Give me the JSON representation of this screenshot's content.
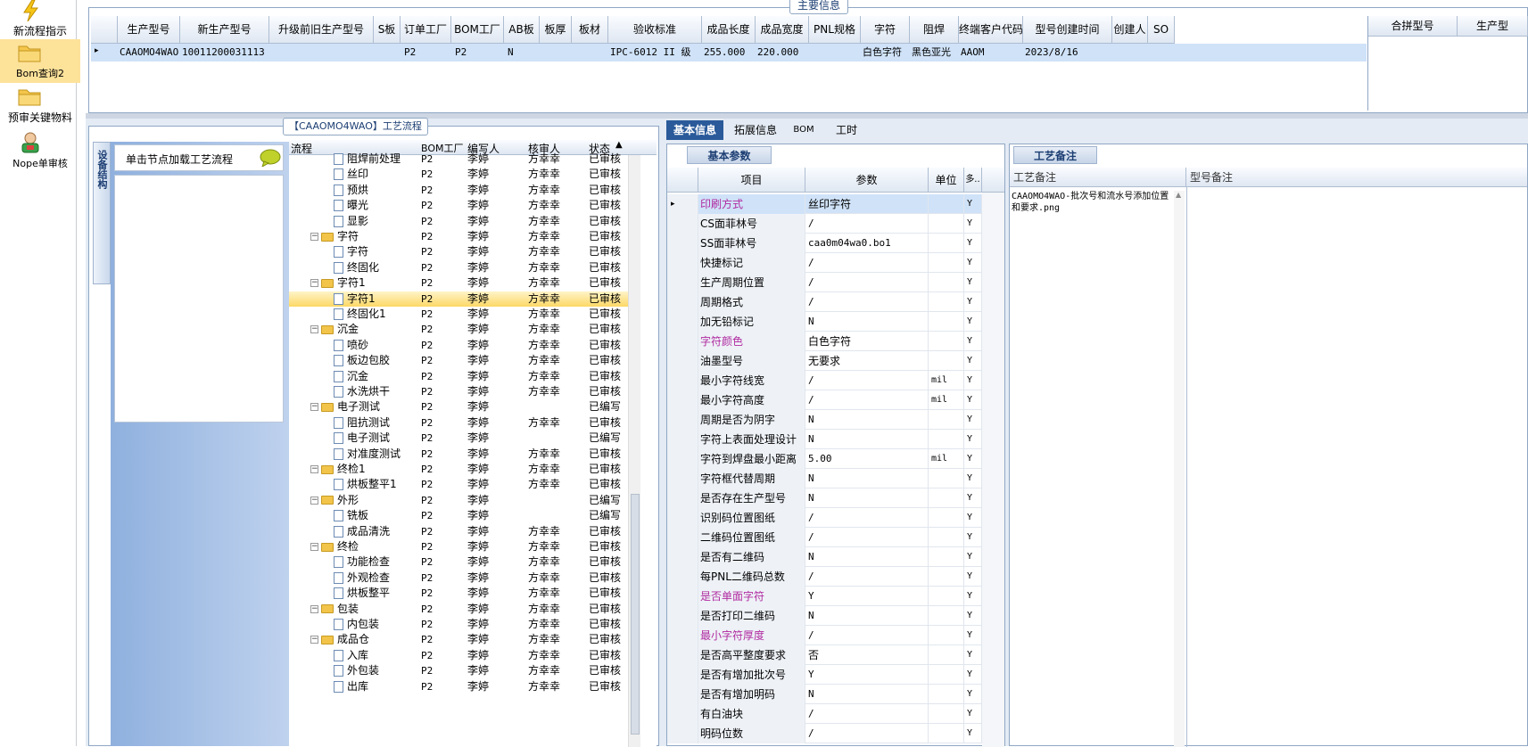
{
  "launcher": {
    "items": [
      {
        "label": "新流程指示"
      },
      {
        "label": "Bom查询2"
      },
      {
        "label": "预审关键物料"
      },
      {
        "label": "Nope单审核"
      }
    ]
  },
  "main_info": {
    "title": "主要信息",
    "columns": [
      "生产型号",
      "新生产型号",
      "升级前旧生产型号",
      "S板",
      "订单工厂",
      "BOM工厂",
      "AB板",
      "板厚",
      "板材",
      "验收标准",
      "成品长度",
      "成品宽度",
      "PNL规格",
      "字符",
      "阻焊",
      "终端客户代码",
      "型号创建时间",
      "创建人",
      "SO"
    ],
    "row": {
      "生产型号": "CAAOMO4WAO",
      "新生产型号": "10011200031113",
      "升级前旧生产型号": "",
      "S板": "",
      "订单工厂": "P2",
      "BOM工厂": "P2",
      "AB板": "N",
      "板厚": "",
      "板材": "",
      "验收标准": "IPC-6012 II 级",
      "成品长度": "255.000",
      "成品宽度": "220.000",
      "PNL规格": "",
      "字符": "白色字符",
      "阻焊": "黑色亚光",
      "终端客户代码": "AAOM",
      "型号创建时间": "2023/8/16",
      "创建人": "",
      "SO": ""
    },
    "right_columns": [
      "合拼型号",
      "生产型"
    ]
  },
  "process": {
    "title": "【CAAOMO4WAO】工艺流程",
    "side_tab": "设备结构",
    "hint": "单击节点加载工艺流程",
    "columns": [
      "流程",
      "BOM工厂",
      "编写人",
      "核审人",
      "状态"
    ],
    "rows": [
      {
        "name": "阻焊前处理",
        "level": 2,
        "kind": "doc",
        "bom": "P2",
        "writer": "李婷",
        "reviewer": "方幸幸",
        "status": "已审核"
      },
      {
        "name": "丝印",
        "level": 2,
        "kind": "doc",
        "bom": "P2",
        "writer": "李婷",
        "reviewer": "方幸幸",
        "status": "已审核"
      },
      {
        "name": "预烘",
        "level": 2,
        "kind": "doc",
        "bom": "P2",
        "writer": "李婷",
        "reviewer": "方幸幸",
        "status": "已审核"
      },
      {
        "name": "曝光",
        "level": 2,
        "kind": "doc",
        "bom": "P2",
        "writer": "李婷",
        "reviewer": "方幸幸",
        "status": "已审核"
      },
      {
        "name": "显影",
        "level": 2,
        "kind": "doc",
        "bom": "P2",
        "writer": "李婷",
        "reviewer": "方幸幸",
        "status": "已审核"
      },
      {
        "name": "字符",
        "level": 1,
        "kind": "folder",
        "bom": "P2",
        "writer": "李婷",
        "reviewer": "方幸幸",
        "status": "已审核"
      },
      {
        "name": "字符",
        "level": 2,
        "kind": "doc",
        "bom": "P2",
        "writer": "李婷",
        "reviewer": "方幸幸",
        "status": "已审核"
      },
      {
        "name": "终固化",
        "level": 2,
        "kind": "doc",
        "bom": "P2",
        "writer": "李婷",
        "reviewer": "方幸幸",
        "status": "已审核"
      },
      {
        "name": "字符1",
        "level": 1,
        "kind": "folder",
        "bom": "P2",
        "writer": "李婷",
        "reviewer": "方幸幸",
        "status": "已审核"
      },
      {
        "name": "字符1",
        "level": 2,
        "kind": "doc",
        "bom": "P2",
        "writer": "李婷",
        "reviewer": "方幸幸",
        "status": "已审核",
        "selected": true
      },
      {
        "name": "终固化1",
        "level": 2,
        "kind": "doc",
        "bom": "P2",
        "writer": "李婷",
        "reviewer": "方幸幸",
        "status": "已审核"
      },
      {
        "name": "沉金",
        "level": 1,
        "kind": "folder",
        "bom": "P2",
        "writer": "李婷",
        "reviewer": "方幸幸",
        "status": "已审核"
      },
      {
        "name": "喷砂",
        "level": 2,
        "kind": "doc",
        "bom": "P2",
        "writer": "李婷",
        "reviewer": "方幸幸",
        "status": "已审核"
      },
      {
        "name": "板边包胶",
        "level": 2,
        "kind": "doc",
        "bom": "P2",
        "writer": "李婷",
        "reviewer": "方幸幸",
        "status": "已审核"
      },
      {
        "name": "沉金",
        "level": 2,
        "kind": "doc",
        "bom": "P2",
        "writer": "李婷",
        "reviewer": "方幸幸",
        "status": "已审核"
      },
      {
        "name": "水洗烘干",
        "level": 2,
        "kind": "doc",
        "bom": "P2",
        "writer": "李婷",
        "reviewer": "方幸幸",
        "status": "已审核"
      },
      {
        "name": "电子测试",
        "level": 1,
        "kind": "folder",
        "bom": "P2",
        "writer": "李婷",
        "reviewer": "",
        "status": "已编写"
      },
      {
        "name": "阻抗测试",
        "level": 2,
        "kind": "doc",
        "bom": "P2",
        "writer": "李婷",
        "reviewer": "方幸幸",
        "status": "已审核"
      },
      {
        "name": "电子测试",
        "level": 2,
        "kind": "doc",
        "bom": "P2",
        "writer": "李婷",
        "reviewer": "",
        "status": "已编写"
      },
      {
        "name": "对准度测试",
        "level": 2,
        "kind": "doc",
        "bom": "P2",
        "writer": "李婷",
        "reviewer": "方幸幸",
        "status": "已审核"
      },
      {
        "name": "终检1",
        "level": 1,
        "kind": "folder",
        "bom": "P2",
        "writer": "李婷",
        "reviewer": "方幸幸",
        "status": "已审核"
      },
      {
        "name": "烘板整平1",
        "level": 2,
        "kind": "doc",
        "bom": "P2",
        "writer": "李婷",
        "reviewer": "方幸幸",
        "status": "已审核"
      },
      {
        "name": "外形",
        "level": 1,
        "kind": "folder",
        "bom": "P2",
        "writer": "李婷",
        "reviewer": "",
        "status": "已编写"
      },
      {
        "name": "铣板",
        "level": 2,
        "kind": "doc",
        "bom": "P2",
        "writer": "李婷",
        "reviewer": "",
        "status": "已编写"
      },
      {
        "name": "成品清洗",
        "level": 2,
        "kind": "doc",
        "bom": "P2",
        "writer": "李婷",
        "reviewer": "方幸幸",
        "status": "已审核"
      },
      {
        "name": "终检",
        "level": 1,
        "kind": "folder",
        "bom": "P2",
        "writer": "李婷",
        "reviewer": "方幸幸",
        "status": "已审核"
      },
      {
        "name": "功能检查",
        "level": 2,
        "kind": "doc",
        "bom": "P2",
        "writer": "李婷",
        "reviewer": "方幸幸",
        "status": "已审核"
      },
      {
        "name": "外观检查",
        "level": 2,
        "kind": "doc",
        "bom": "P2",
        "writer": "李婷",
        "reviewer": "方幸幸",
        "status": "已审核"
      },
      {
        "name": "烘板整平",
        "level": 2,
        "kind": "doc",
        "bom": "P2",
        "writer": "李婷",
        "reviewer": "方幸幸",
        "status": "已审核"
      },
      {
        "name": "包装",
        "level": 1,
        "kind": "folder",
        "bom": "P2",
        "writer": "李婷",
        "reviewer": "方幸幸",
        "status": "已审核"
      },
      {
        "name": "内包装",
        "level": 2,
        "kind": "doc",
        "bom": "P2",
        "writer": "李婷",
        "reviewer": "方幸幸",
        "status": "已审核"
      },
      {
        "name": "成品仓",
        "level": 1,
        "kind": "folder",
        "bom": "P2",
        "writer": "李婷",
        "reviewer": "方幸幸",
        "status": "已审核"
      },
      {
        "name": "入库",
        "level": 2,
        "kind": "doc",
        "bom": "P2",
        "writer": "李婷",
        "reviewer": "方幸幸",
        "status": "已审核"
      },
      {
        "name": "外包装",
        "level": 2,
        "kind": "doc",
        "bom": "P2",
        "writer": "李婷",
        "reviewer": "方幸幸",
        "status": "已审核"
      },
      {
        "name": "出库",
        "level": 2,
        "kind": "doc",
        "bom": "P2",
        "writer": "李婷",
        "reviewer": "方幸幸",
        "status": "已审核"
      }
    ]
  },
  "detail_tabs": [
    "基本信息",
    "拓展信息",
    "BOM",
    "工时"
  ],
  "basic_params": {
    "title": "基本参数",
    "columns": [
      "项目",
      "参数",
      "单位",
      "多.."
    ],
    "rows": [
      {
        "item": "印刷方式",
        "param": "丝印字符",
        "unit": "",
        "flag": "Y",
        "highlight": true
      },
      {
        "item": "CS面菲林号",
        "param": "/",
        "unit": "",
        "flag": "Y"
      },
      {
        "item": "SS面菲林号",
        "param": "caa0m04wa0.bo1",
        "unit": "",
        "flag": "Y"
      },
      {
        "item": "快捷标记",
        "param": "/",
        "unit": "",
        "flag": "Y"
      },
      {
        "item": "生产周期位置",
        "param": "/",
        "unit": "",
        "flag": "Y"
      },
      {
        "item": "周期格式",
        "param": "/",
        "unit": "",
        "flag": "Y"
      },
      {
        "item": "加无铅标记",
        "param": "N",
        "unit": "",
        "flag": "Y"
      },
      {
        "item": "字符颜色",
        "param": "白色字符",
        "unit": "",
        "flag": "Y",
        "highlight": true
      },
      {
        "item": "油墨型号",
        "param": "无要求",
        "unit": "",
        "flag": "Y"
      },
      {
        "item": "最小字符线宽",
        "param": "/",
        "unit": "mil",
        "flag": "Y"
      },
      {
        "item": "最小字符高度",
        "param": "/",
        "unit": "mil",
        "flag": "Y"
      },
      {
        "item": "周期是否为阴字",
        "param": "N",
        "unit": "",
        "flag": "Y"
      },
      {
        "item": "字符上表面处理设计",
        "param": "N",
        "unit": "",
        "flag": "Y"
      },
      {
        "item": "字符到焊盘最小距离",
        "param": "5.00",
        "unit": "mil",
        "flag": "Y"
      },
      {
        "item": "字符框代替周期",
        "param": "N",
        "unit": "",
        "flag": "Y"
      },
      {
        "item": "是否存在生产型号",
        "param": "N",
        "unit": "",
        "flag": "Y"
      },
      {
        "item": "识别码位置图纸",
        "param": "/",
        "unit": "",
        "flag": "Y"
      },
      {
        "item": "二维码位置图纸",
        "param": "/",
        "unit": "",
        "flag": "Y"
      },
      {
        "item": "是否有二维码",
        "param": "N",
        "unit": "",
        "flag": "Y"
      },
      {
        "item": "每PNL二维码总数",
        "param": "/",
        "unit": "",
        "flag": "Y"
      },
      {
        "item": "是否单面字符",
        "param": "Y",
        "unit": "",
        "flag": "Y",
        "highlight": true
      },
      {
        "item": "是否打印二维码",
        "param": "N",
        "unit": "",
        "flag": "Y"
      },
      {
        "item": "最小字符厚度",
        "param": "/",
        "unit": "",
        "flag": "Y",
        "highlight": true
      },
      {
        "item": "是否高平整度要求",
        "param": "否",
        "unit": "",
        "flag": "Y"
      },
      {
        "item": "是否有增加批次号",
        "param": "Y",
        "unit": "",
        "flag": "Y"
      },
      {
        "item": "是否有增加明码",
        "param": "N",
        "unit": "",
        "flag": "Y"
      },
      {
        "item": "有白油块",
        "param": "/",
        "unit": "",
        "flag": "Y"
      },
      {
        "item": "明码位数",
        "param": "/",
        "unit": "",
        "flag": "Y"
      }
    ]
  },
  "process_notes": {
    "title": "工艺备注",
    "columns": [
      "工艺备注",
      "型号备注"
    ],
    "note": "CAAOMO4WAO-批次号和流水号添加位置和要求.png"
  },
  "colors": {
    "highlight_text": "#b02aa0",
    "selected_row": "#cfe2f8",
    "accent": "#2a5a9a"
  }
}
